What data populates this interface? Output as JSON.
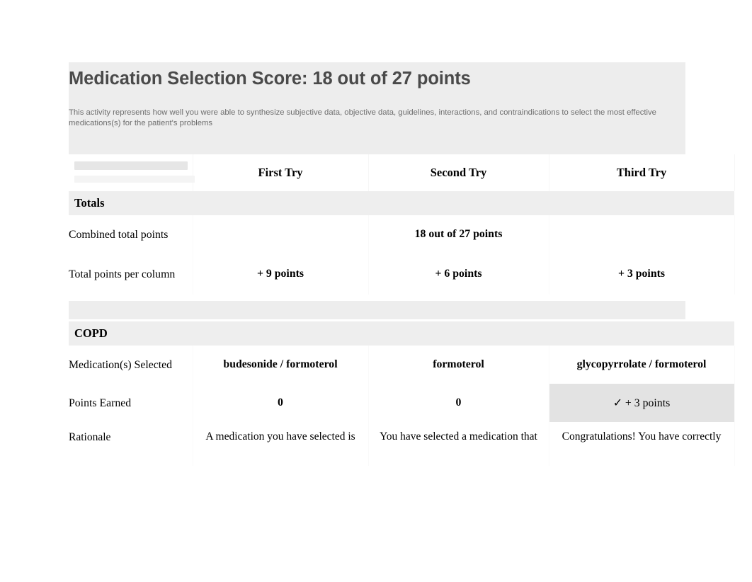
{
  "header": {
    "title": "Medication Selection Score: 18 out of 27 points",
    "description": "This activity represents how well you were able to synthesize subjective data, objective data, guidelines, interactions, and contraindications to select the most effective medications(s) for the patient's problems"
  },
  "colors": {
    "panel_background": "#ededed",
    "section_band": "#eeeeee",
    "highlight_cell": "#e3e3e3",
    "title_text": "#4a4a4a",
    "description_text": "#6e6e6e",
    "page_background": "#ffffff"
  },
  "table": {
    "column_headers": {
      "corner": "",
      "try1": "First Try",
      "try2": "Second Try",
      "try3": "Third Try"
    },
    "totals_section": {
      "heading": "Totals",
      "rows": [
        {
          "label": "Combined total points",
          "try1": "",
          "try2": "18 out of 27 points",
          "try3": ""
        },
        {
          "label": "Total points per column",
          "try1": "+ 9 points",
          "try2": "+ 6 points",
          "try3": "+ 3 points"
        }
      ]
    },
    "copd_section": {
      "heading": "COPD",
      "rows": [
        {
          "label": "Medication(s) Selected",
          "try1": "budesonide / formoterol",
          "try2": "formoterol",
          "try3": "glycopyrrolate / formoterol"
        },
        {
          "label": "Points Earned",
          "try1": "0",
          "try2": "0",
          "try3": "✓ + 3 points"
        },
        {
          "label": "Rationale",
          "try1": "A medication you have selected is",
          "try2": "You have selected a medication that",
          "try3": "Congratulations! You have correctly"
        }
      ]
    }
  },
  "icons": {
    "check_mark": "✓"
  }
}
